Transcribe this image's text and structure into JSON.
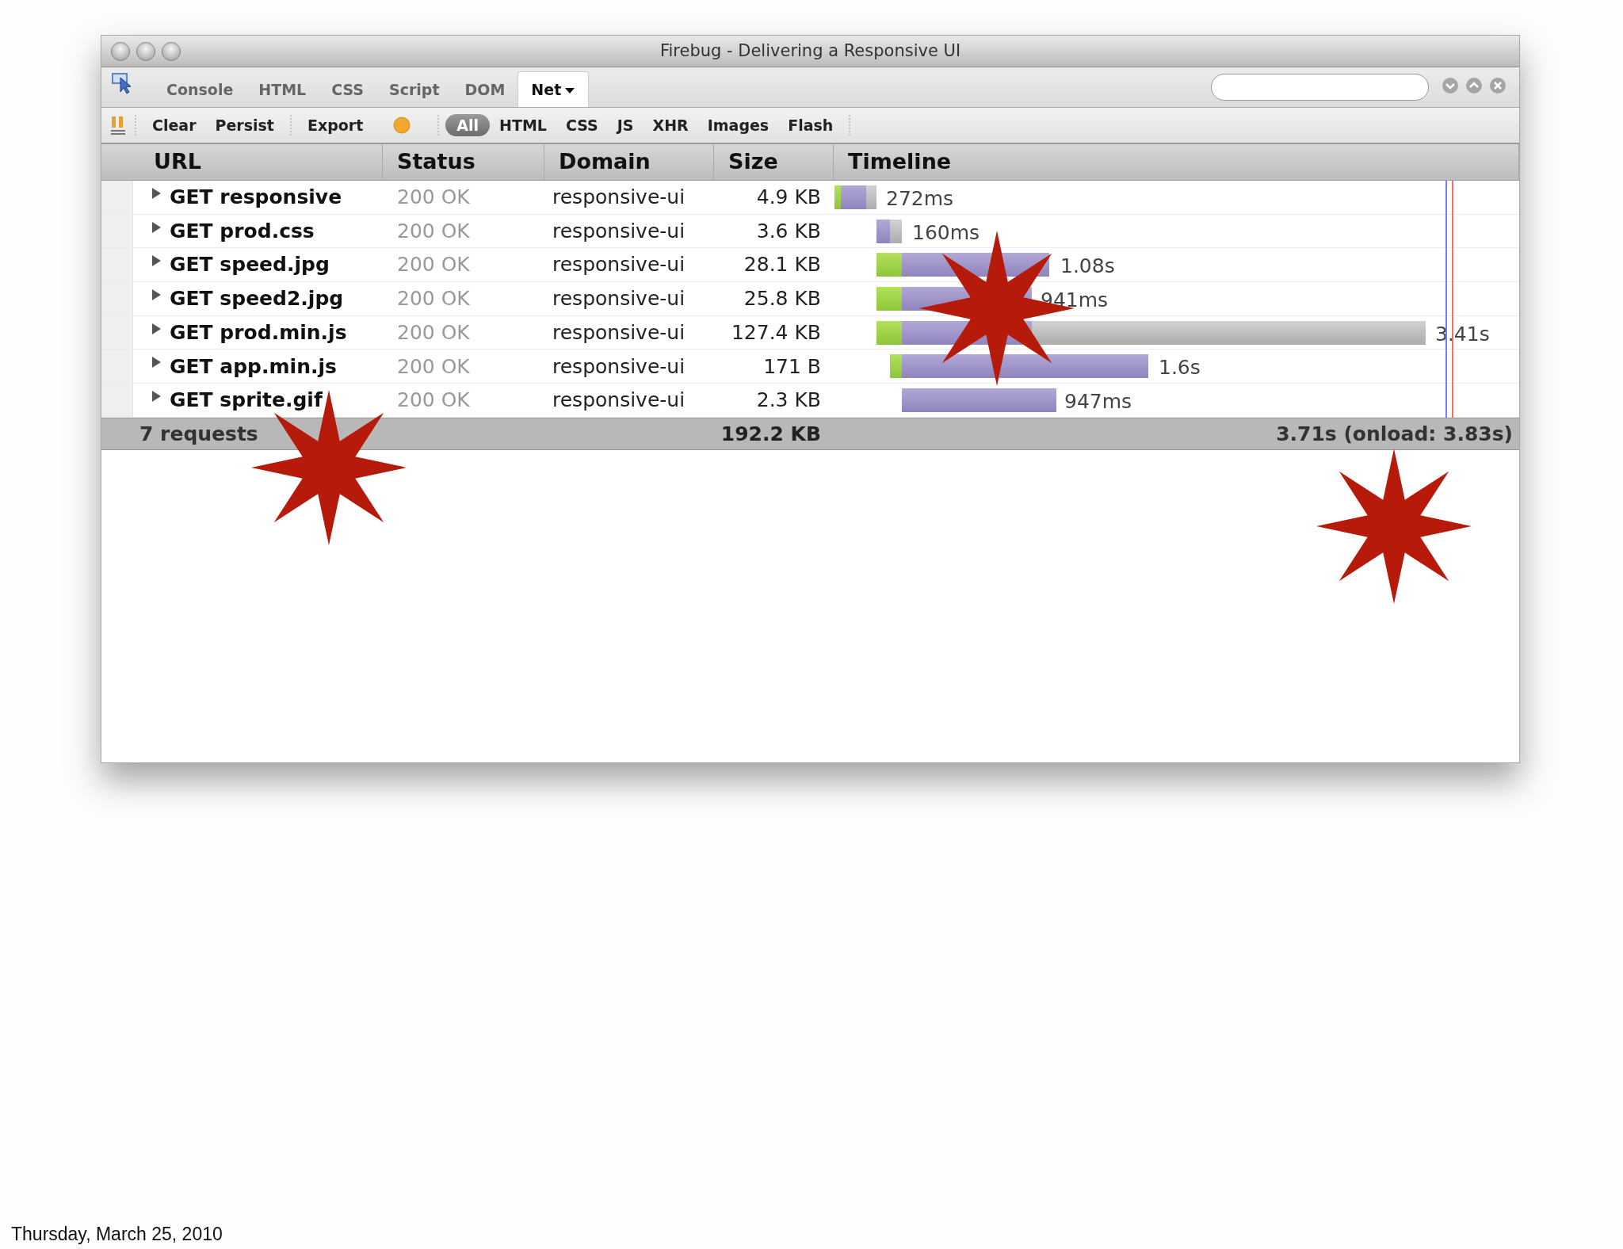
{
  "window": {
    "title": "Firebug - Delivering a Responsive UI"
  },
  "tabs": [
    {
      "label": "Console",
      "selected": false
    },
    {
      "label": "HTML",
      "selected": false
    },
    {
      "label": "CSS",
      "selected": false
    },
    {
      "label": "Script",
      "selected": false
    },
    {
      "label": "DOM",
      "selected": false
    },
    {
      "label": "Net",
      "selected": true
    }
  ],
  "toolbar": {
    "buttons": [
      "Clear",
      "Persist",
      "Export"
    ],
    "filters": [
      {
        "label": "All",
        "selected": true
      },
      {
        "label": "HTML",
        "selected": false
      },
      {
        "label": "CSS",
        "selected": false
      },
      {
        "label": "JS",
        "selected": false
      },
      {
        "label": "XHR",
        "selected": false
      },
      {
        "label": "Images",
        "selected": false
      },
      {
        "label": "Flash",
        "selected": false
      }
    ]
  },
  "table": {
    "columns": [
      "URL",
      "Status",
      "Domain",
      "Size",
      "Timeline"
    ],
    "rows": [
      {
        "url": "GET responsive",
        "status": "200 OK",
        "domain": "responsive-ui",
        "size": "4.9 KB",
        "time": "272ms"
      },
      {
        "url": "GET prod.css",
        "status": "200 OK",
        "domain": "responsive-ui",
        "size": "3.6 KB",
        "time": "160ms"
      },
      {
        "url": "GET speed.jpg",
        "status": "200 OK",
        "domain": "responsive-ui",
        "size": "28.1 KB",
        "time": "1.08s"
      },
      {
        "url": "GET speed2.jpg",
        "status": "200 OK",
        "domain": "responsive-ui",
        "size": "25.8 KB",
        "time": "941ms"
      },
      {
        "url": "GET prod.min.js",
        "status": "200 OK",
        "domain": "responsive-ui",
        "size": "127.4 KB",
        "time": "3.41s"
      },
      {
        "url": "GET app.min.js",
        "status": "200 OK",
        "domain": "responsive-ui",
        "size": "171 B",
        "time": "1.6s"
      },
      {
        "url": "GET sprite.gif",
        "status": "200 OK",
        "domain": "responsive-ui",
        "size": "2.3 KB",
        "time": "947ms"
      }
    ],
    "footer": {
      "requests": "7 requests",
      "size": "192.2 KB",
      "time": "3.71s (onload: 3.83s)"
    }
  },
  "slide": {
    "date": "Thursday, March 25, 2010"
  }
}
